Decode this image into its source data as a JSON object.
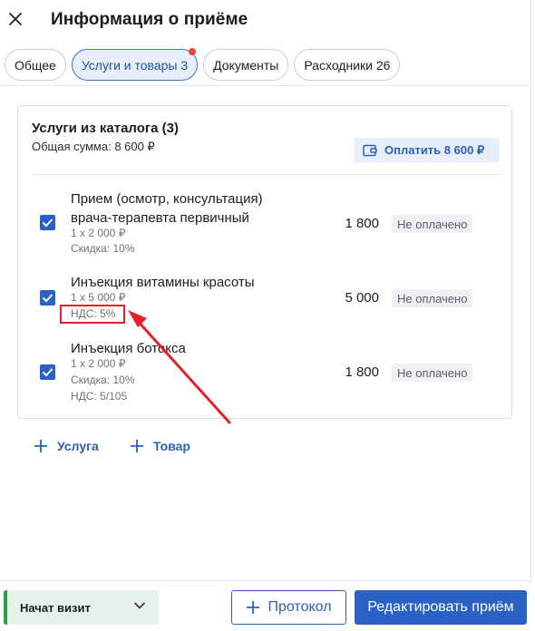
{
  "header": {
    "title": "Информация о приёме",
    "close_icon": "close-icon"
  },
  "tabs": [
    {
      "label": "Общее",
      "active": false
    },
    {
      "label": "Услуги и товары 3",
      "active": true,
      "has_notification_dot": true
    },
    {
      "label": "Документы",
      "active": false
    },
    {
      "label": "Расходники 26",
      "active": false
    }
  ],
  "services": {
    "title": "Услуги из каталога (3)",
    "total": "Общая сумма: 8 600 ₽",
    "pay_button": "Оплатить 8 600 ₽",
    "items": [
      {
        "name": "Прием (осмотр, консультация) врача-терапевта первичный",
        "qty": "1 х 2 000 ₽",
        "discount": "Скидка: 10%",
        "price": "1 800",
        "status": "Не оплачено",
        "checked": true
      },
      {
        "name": "Инъекция витамины красоты",
        "qty": "1 х 5 000 ₽",
        "vat": "НДС: 5%",
        "price": "5 000",
        "status": "Не оплачено",
        "checked": true
      },
      {
        "name": "Инъекция ботокса",
        "qty": "1 х 2 000 ₽",
        "discount": "Скидка: 10%",
        "vat": "НДС: 5/105",
        "price": "1 800",
        "status": "Не оплачено",
        "checked": true
      }
    ]
  },
  "actions": {
    "add_service": "Услуга",
    "add_product": "Товар"
  },
  "footer": {
    "visit_status": "Начат визит",
    "protocol_button": "Протокол",
    "edit_button": "Редактировать приём"
  },
  "colors": {
    "accent": "#2962c4",
    "annotation": "#e3202a",
    "visit_green": "#2e9a4a"
  }
}
